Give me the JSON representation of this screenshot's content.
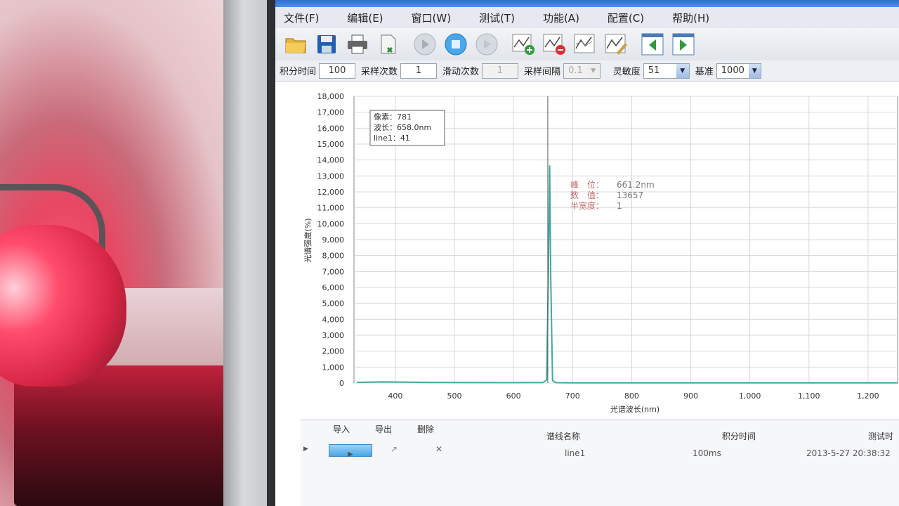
{
  "menu": [
    {
      "label": "文件(F)"
    },
    {
      "label": "编辑(E)"
    },
    {
      "label": "窗口(W)"
    },
    {
      "label": "测试(T)"
    },
    {
      "label": "功能(A)"
    },
    {
      "label": "配置(C)"
    },
    {
      "label": "帮助(H)"
    }
  ],
  "toolbar": {
    "icons": [
      "open-folder-icon",
      "save-icon",
      "print-icon",
      "export-icon",
      "play-icon",
      "stop-icon",
      "step-icon",
      "add-curve-icon",
      "delete-curve-icon",
      "overlay-curve-icon",
      "edit-curve-icon",
      "prev-icon",
      "next-icon"
    ]
  },
  "params": {
    "integration_time_label": "积分时间",
    "integration_time_value": "100",
    "sample_count_label": "采样次数",
    "sample_count_value": "1",
    "smoothing_label": "滑动次数",
    "smoothing_value": "1",
    "sample_interval_label": "采样间隔",
    "sample_interval_value": "0.1",
    "sensitivity_label": "灵敏度",
    "sensitivity_value": "51",
    "baseline_label": "基准",
    "baseline_value": "1000"
  },
  "chart_data": {
    "type": "line",
    "ylabel": "光谱强度(%)",
    "xlabel": "光谱波长(nm)",
    "ylim": [
      0,
      18000
    ],
    "xlim": [
      330,
      1250
    ],
    "yticks": [
      0,
      1000,
      2000,
      3000,
      4000,
      5000,
      6000,
      7000,
      8000,
      9000,
      10000,
      11000,
      12000,
      13000,
      14000,
      15000,
      16000,
      17000,
      18000
    ],
    "ytick_labels": [
      "0",
      "1,000",
      "2,000",
      "3,000",
      "4,000",
      "5,000",
      "6,000",
      "7,000",
      "8,000",
      "9,000",
      "10,000",
      "11,000",
      "12,000",
      "13,000",
      "14,000",
      "15,000",
      "16,000",
      "17,000",
      "18,000"
    ],
    "xticks": [
      400,
      500,
      600,
      700,
      800,
      900,
      1000,
      1100,
      1200
    ],
    "xtick_labels": [
      "400",
      "500",
      "600",
      "700",
      "800",
      "900",
      "1,000",
      "1,100",
      "1,200"
    ],
    "grid": true,
    "series": [
      {
        "name": "line1",
        "x": [
          335,
          380,
          420,
          460,
          520,
          600,
          650,
          656,
          659,
          661.2,
          663,
          666,
          672,
          700,
          800,
          900,
          1000,
          1100,
          1200,
          1250
        ],
        "y": [
          40,
          70,
          55,
          35,
          25,
          20,
          25,
          200,
          7000,
          13657,
          6500,
          150,
          20,
          15,
          10,
          10,
          10,
          10,
          10,
          10
        ],
        "color": "#3fa9a0"
      }
    ],
    "cursor": {
      "x": 658.0,
      "pixel_label": "像素：781",
      "wavelength_label": "波长：658.0nm",
      "value_label": "line1：41"
    },
    "peak": {
      "position_label": "峰　位：",
      "position_value": "661.2nm",
      "value_label": "数　值：",
      "value_value": "13657",
      "fwhm_label": "半宽度：",
      "fwhm_value": "1"
    }
  },
  "bottom": {
    "import_label": "导入",
    "export_label": "导出",
    "delete_label": "删除",
    "col_curve_name": "谱线名称",
    "col_integration_time": "积分时间",
    "col_test_time": "测试时",
    "row": {
      "name": "line1",
      "integration": "100ms",
      "time": "2013-5-27 20:38:32"
    }
  },
  "colors": {
    "accent": "#2f6fd0",
    "series": "#3fa9a0",
    "peak_text": "#c26b6b"
  }
}
